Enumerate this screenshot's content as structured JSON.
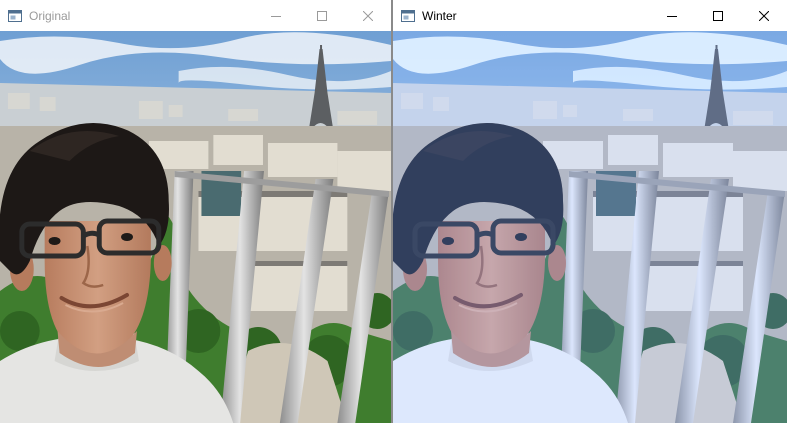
{
  "windows": [
    {
      "title": "Original",
      "active": false,
      "icon": "image-window-icon",
      "buttons": [
        "minimize-icon",
        "maximize-icon",
        "close-icon"
      ],
      "image": {
        "subject": "selfie-eiffel-tower",
        "filter": "none"
      }
    },
    {
      "title": "Winter",
      "active": true,
      "icon": "image-window-icon",
      "buttons": [
        "minimize-icon",
        "maximize-icon",
        "close-icon"
      ],
      "image": {
        "subject": "selfie-eiffel-tower",
        "filter": "winter"
      }
    }
  ],
  "colors": {
    "sky": "#8fb6dd",
    "cloud": "#e9f0f7",
    "hair": "#1d1816",
    "skin": "#c48c6d",
    "shirt": "#e5e5e3",
    "trees": "#3f7d2e",
    "rail": "#b9b9b9"
  }
}
